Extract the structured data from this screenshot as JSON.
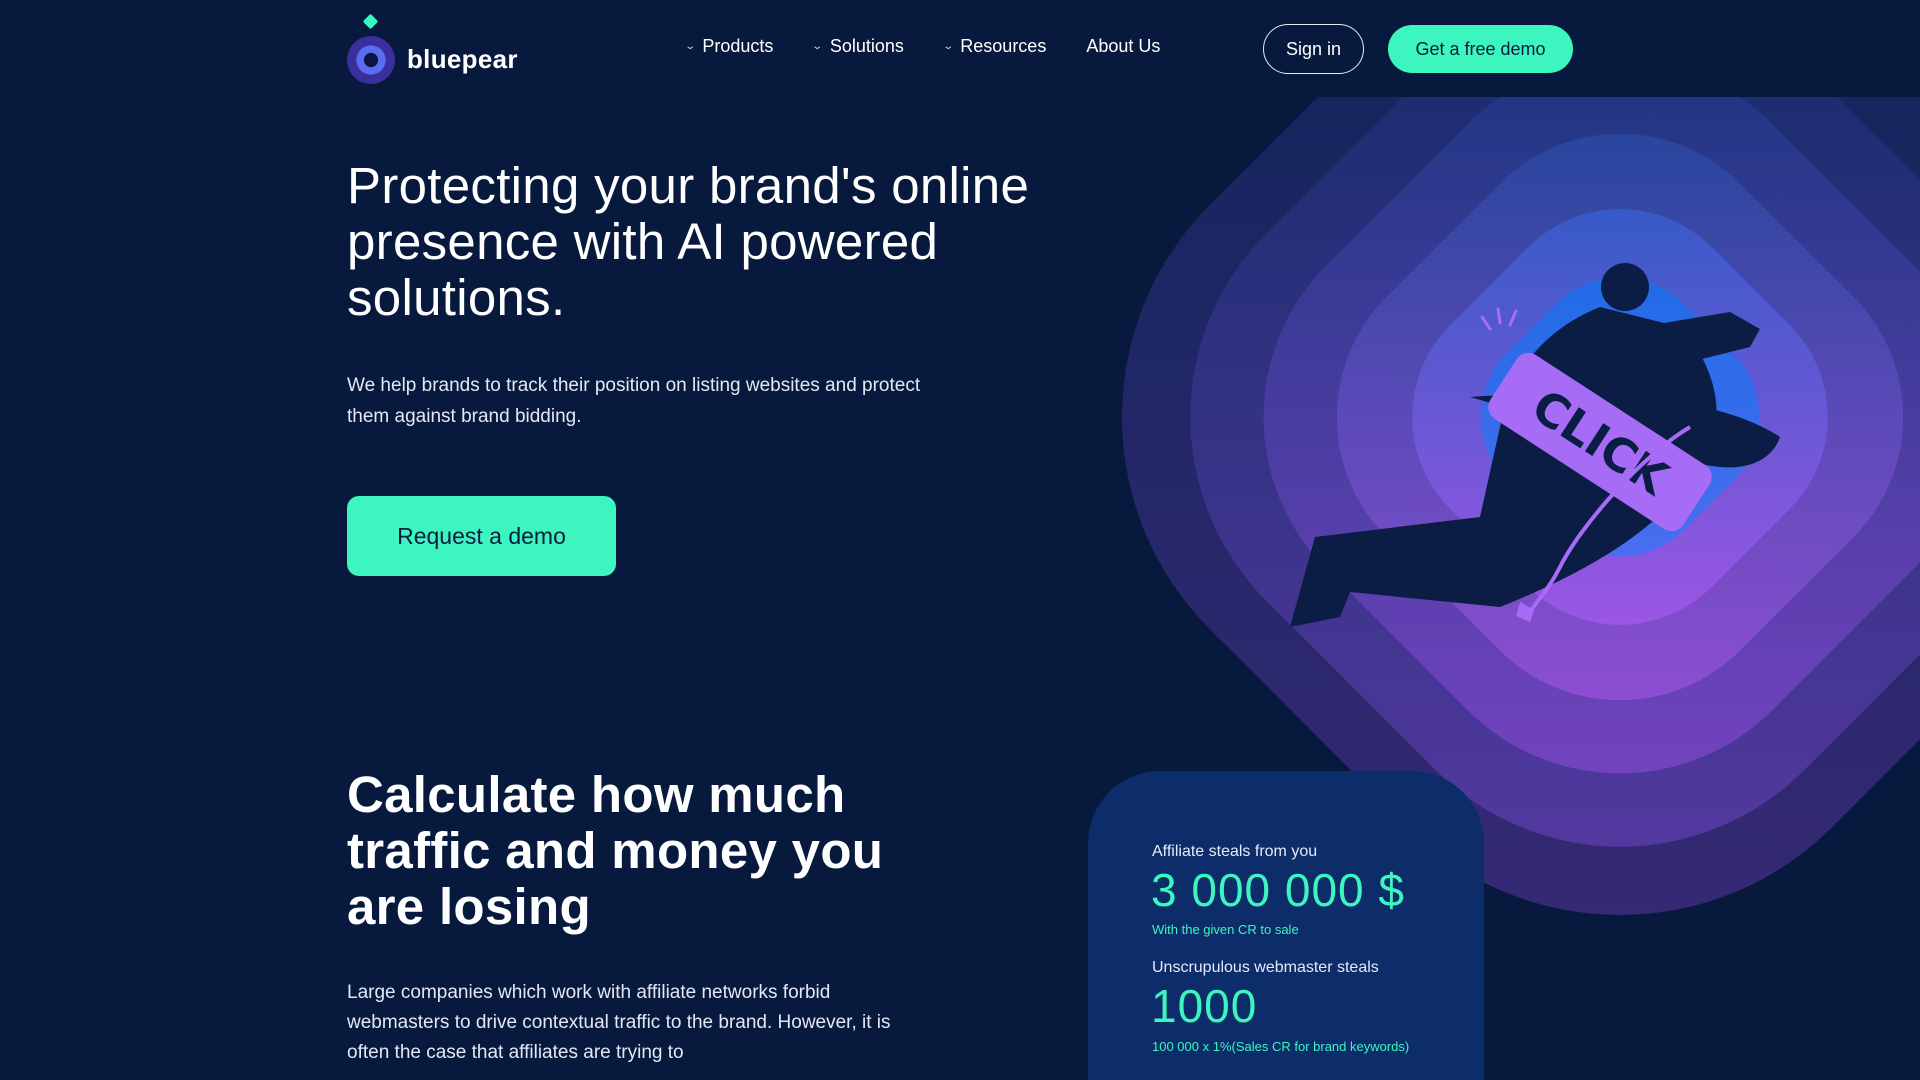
{
  "brand": {
    "name": "bluepear",
    "accent": "#3df5be",
    "background": "#071a3d"
  },
  "nav": {
    "items": [
      {
        "label": "Products",
        "dropdown": true
      },
      {
        "label": "Solutions",
        "dropdown": true
      },
      {
        "label": "Resources",
        "dropdown": true
      },
      {
        "label": "About Us",
        "dropdown": false
      }
    ],
    "sign_in": "Sign in",
    "free_demo": "Get a free demo"
  },
  "hero": {
    "title": "Protecting your brand's online presence with AI powered solutions.",
    "subtitle": "We help brands to track their position on listing websites and protect them against brand bidding.",
    "cta": "Request a demo",
    "illustration_text": "CLICK"
  },
  "calculator": {
    "title": "Calculate how much traffic and money you are losing",
    "text": "Large companies which work with affiliate networks forbid webmasters to drive contextual traffic to the brand. However, it is often the case that affiliates are trying to",
    "card": {
      "label_1": "Affiliate steals from you",
      "value_1": "3 000 000 $",
      "note_1": "With the given CR to sale",
      "label_2": "Unscrupulous webmaster steals",
      "value_2": "1000",
      "note_2": "100 000 x 1%(Sales CR for brand keywords)"
    }
  }
}
